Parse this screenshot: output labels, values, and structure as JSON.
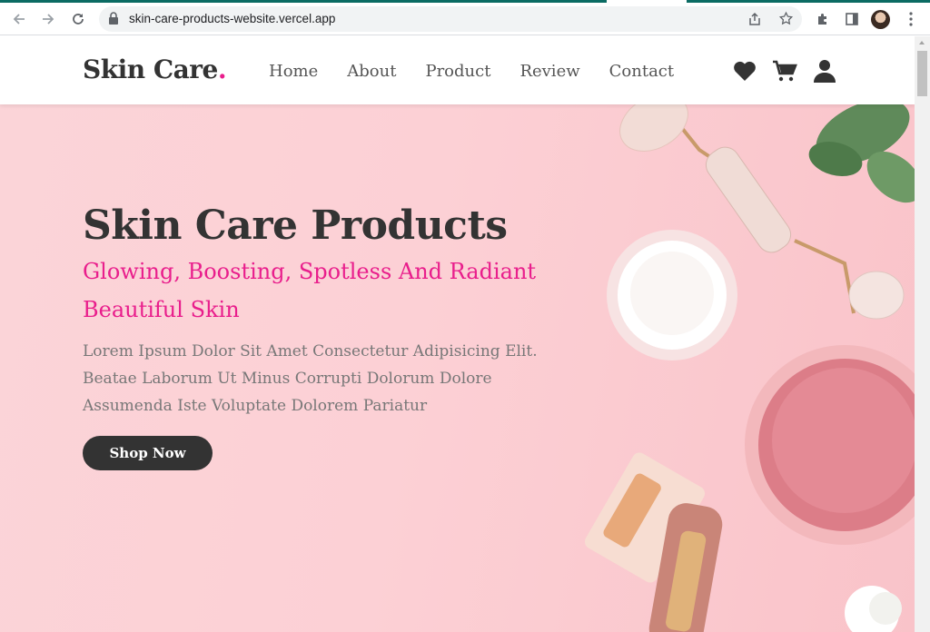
{
  "browser": {
    "url": "skin-care-products-website.vercel.app"
  },
  "site": {
    "logo_text": "Skin Care",
    "logo_dot": ".",
    "nav": [
      {
        "label": "Home"
      },
      {
        "label": "About"
      },
      {
        "label": "Product"
      },
      {
        "label": "Review"
      },
      {
        "label": "Contact"
      }
    ],
    "icons": [
      "heart-icon",
      "cart-icon",
      "user-icon"
    ]
  },
  "hero": {
    "title": "Skin Care Products",
    "subtitle": "Glowing, Boosting, Spotless And Radiant Beautiful Skin",
    "description": "Lorem Ipsum Dolor Sit Amet Consectetur Adipisicing Elit. Beatae Laborum Ut Minus Corrupti Dolorum Dolore Assumenda Iste Voluptate Dolorem Pariatur",
    "button_label": "Shop Now"
  },
  "colors": {
    "accent": "#e91e8c",
    "dark": "#333333",
    "hero_bg": "#fcd2d6",
    "browser_accent": "#0b6b63"
  }
}
